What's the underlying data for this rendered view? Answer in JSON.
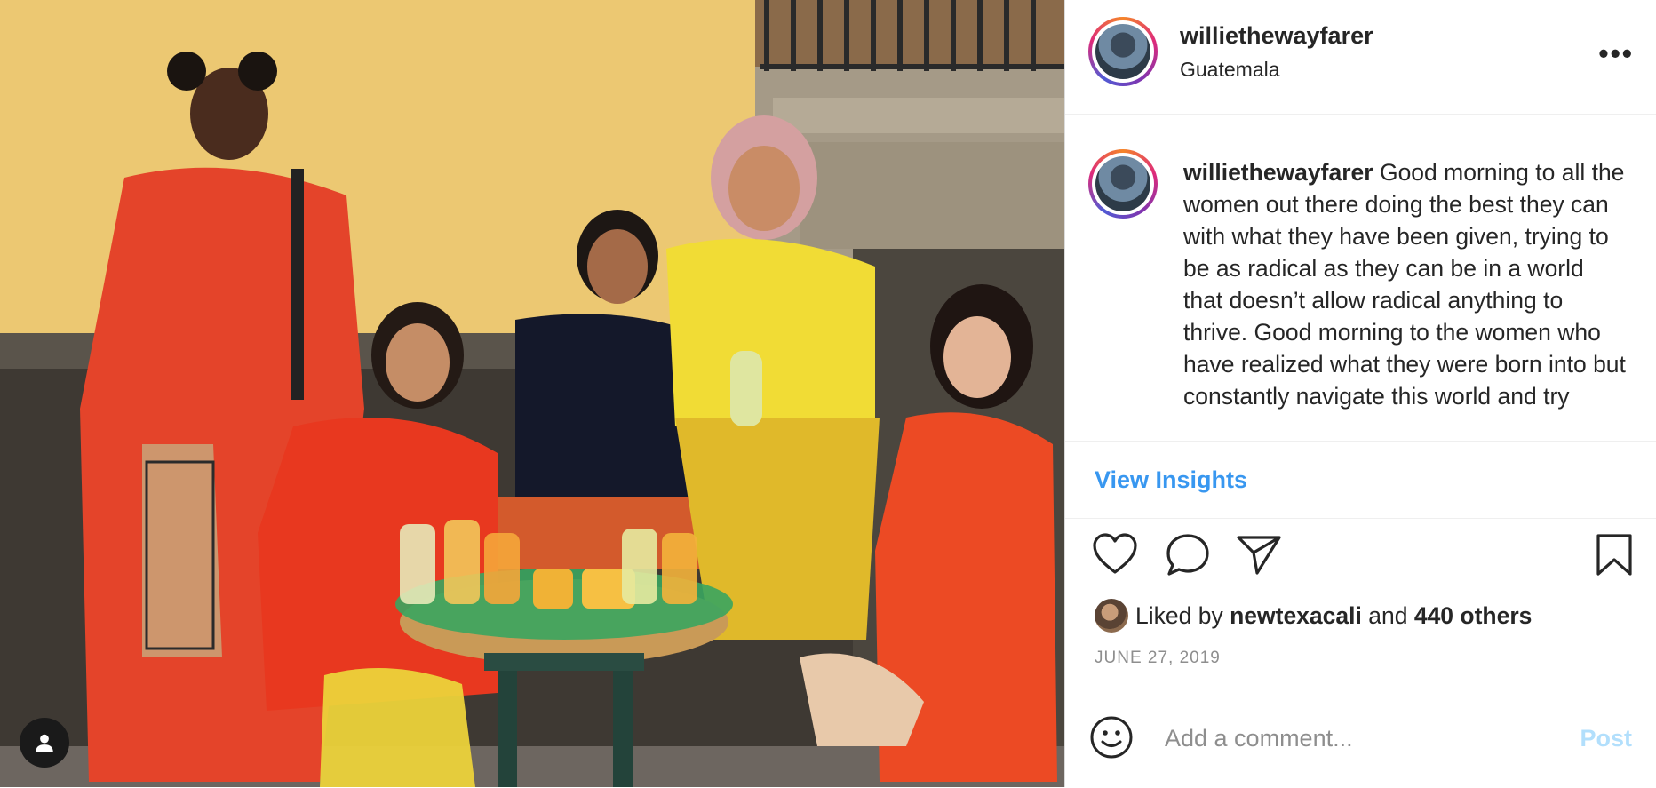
{
  "post": {
    "username": "williethewayfarer",
    "location": "Guatemala",
    "more_icon": "more-options-icon",
    "caption_text": "Good morning to all the women out there doing the best they can with what they have been given, trying to be as radical as they can be in a world that doesn’t allow radical anything to thrive. Good morning to the women who have realized what they were born into but constantly navigate this world and try",
    "insights_label": "View Insights",
    "likes": {
      "prefix": "Liked by",
      "liker": "newtexacali",
      "and": "and",
      "others": "440 others"
    },
    "date": "JUNE 27, 2019",
    "comment_placeholder": "Add a comment...",
    "post_label": "Post"
  },
  "colors": {
    "link_blue": "#3897f0",
    "post_disabled": "#b2dffc",
    "muted": "#8e8e8e",
    "text": "#262626"
  },
  "icons": [
    "heart-icon",
    "comment-icon",
    "share-icon",
    "bookmark-icon",
    "emoji-icon",
    "user-tag-icon"
  ]
}
